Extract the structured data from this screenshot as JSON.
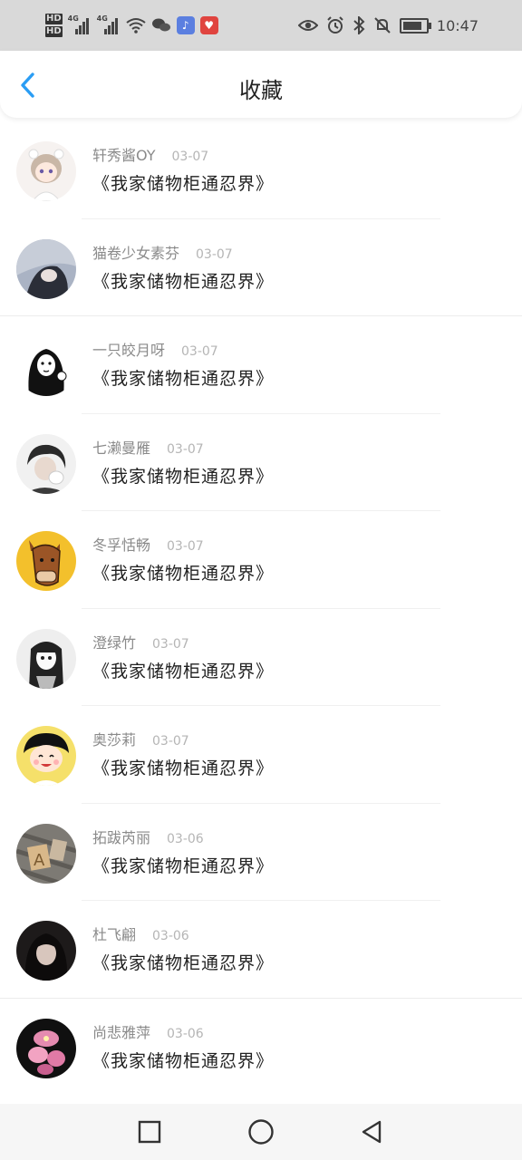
{
  "status": {
    "hd1": "HD",
    "hd2": "HD",
    "net1": "4G",
    "net2": "4G",
    "time": "10:47"
  },
  "header": {
    "title": "收藏"
  },
  "favorites": [
    {
      "user": "轩秀酱OY",
      "date": "03-07",
      "book": "《我家储物柜通忍界》"
    },
    {
      "user": "猫卷少女素芬",
      "date": "03-07",
      "book": "《我家储物柜通忍界》"
    },
    {
      "user": "一只皎月呀",
      "date": "03-07",
      "book": "《我家储物柜通忍界》"
    },
    {
      "user": "七濑曼雁",
      "date": "03-07",
      "book": "《我家储物柜通忍界》"
    },
    {
      "user": "冬孚恬畅",
      "date": "03-07",
      "book": "《我家储物柜通忍界》"
    },
    {
      "user": "澄绿竹",
      "date": "03-07",
      "book": "《我家储物柜通忍界》"
    },
    {
      "user": "奥莎莉",
      "date": "03-07",
      "book": "《我家储物柜通忍界》"
    },
    {
      "user": "拓跋芮丽",
      "date": "03-06",
      "book": "《我家储物柜通忍界》"
    },
    {
      "user": "杜飞翩",
      "date": "03-06",
      "book": "《我家储物柜通忍界》"
    },
    {
      "user": "尚悲雅萍",
      "date": "03-06",
      "book": "《我家储物柜通忍界》"
    }
  ],
  "icons": {
    "back": "chevron-left-icon",
    "recent": "square-icon",
    "home": "circle-icon",
    "nav_back": "triangle-left-icon"
  },
  "colors": {
    "accent": "#2a9df4",
    "statusbar": "#d9d9d9"
  }
}
